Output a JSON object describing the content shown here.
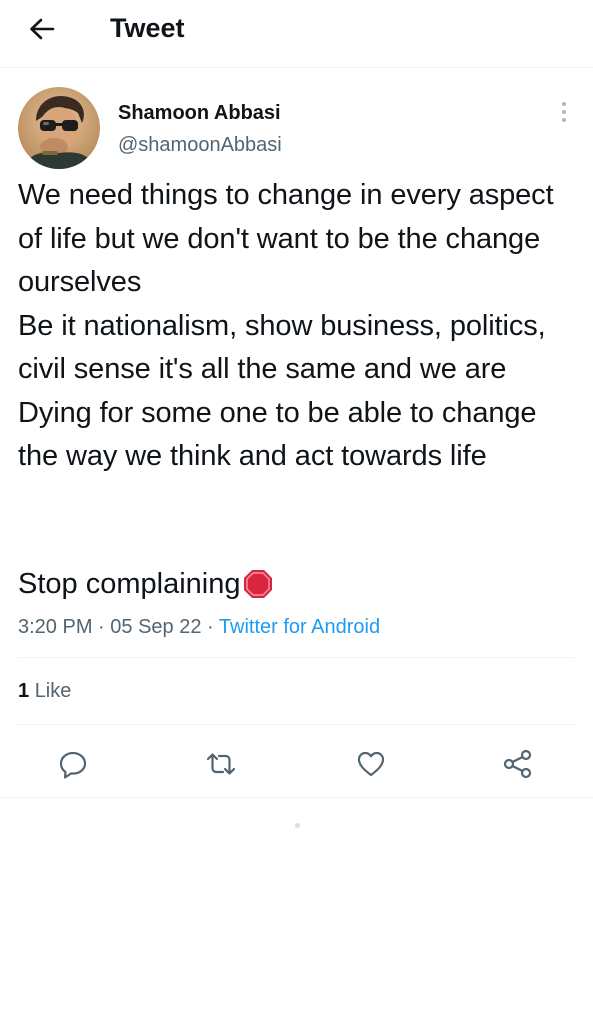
{
  "header": {
    "title": "Tweet",
    "back_icon": "arrow-left-icon"
  },
  "author": {
    "name": "Shamoon Abbasi",
    "handle": "@shamoonAbbasi",
    "avatar": "avatar"
  },
  "tweet": {
    "paragraph_1": "We need things to change in every aspect of life but we don't want to be the change ourselves",
    "paragraph_2": "Be it nationalism, show business, politics, civil sense it's all the same and we are Dying for some one to be able to change the way we think and act towards life",
    "closing": "Stop complaining",
    "closing_emoji": "stop-sign-icon"
  },
  "meta": {
    "time": "3:20 PM",
    "date": "05 Sep 22",
    "separator": "·",
    "source": "Twitter for Android"
  },
  "stats": {
    "likes_count": "1",
    "likes_label": "Like"
  },
  "actions": {
    "reply_icon": "reply-icon",
    "retweet_icon": "retweet-icon",
    "like_icon": "heart-icon",
    "share_icon": "share-icon"
  },
  "colors": {
    "text": "#0f1419",
    "secondary": "#536471",
    "accent": "#1d9bf0",
    "border": "#eff3f4",
    "stop_red": "#d7263d"
  }
}
